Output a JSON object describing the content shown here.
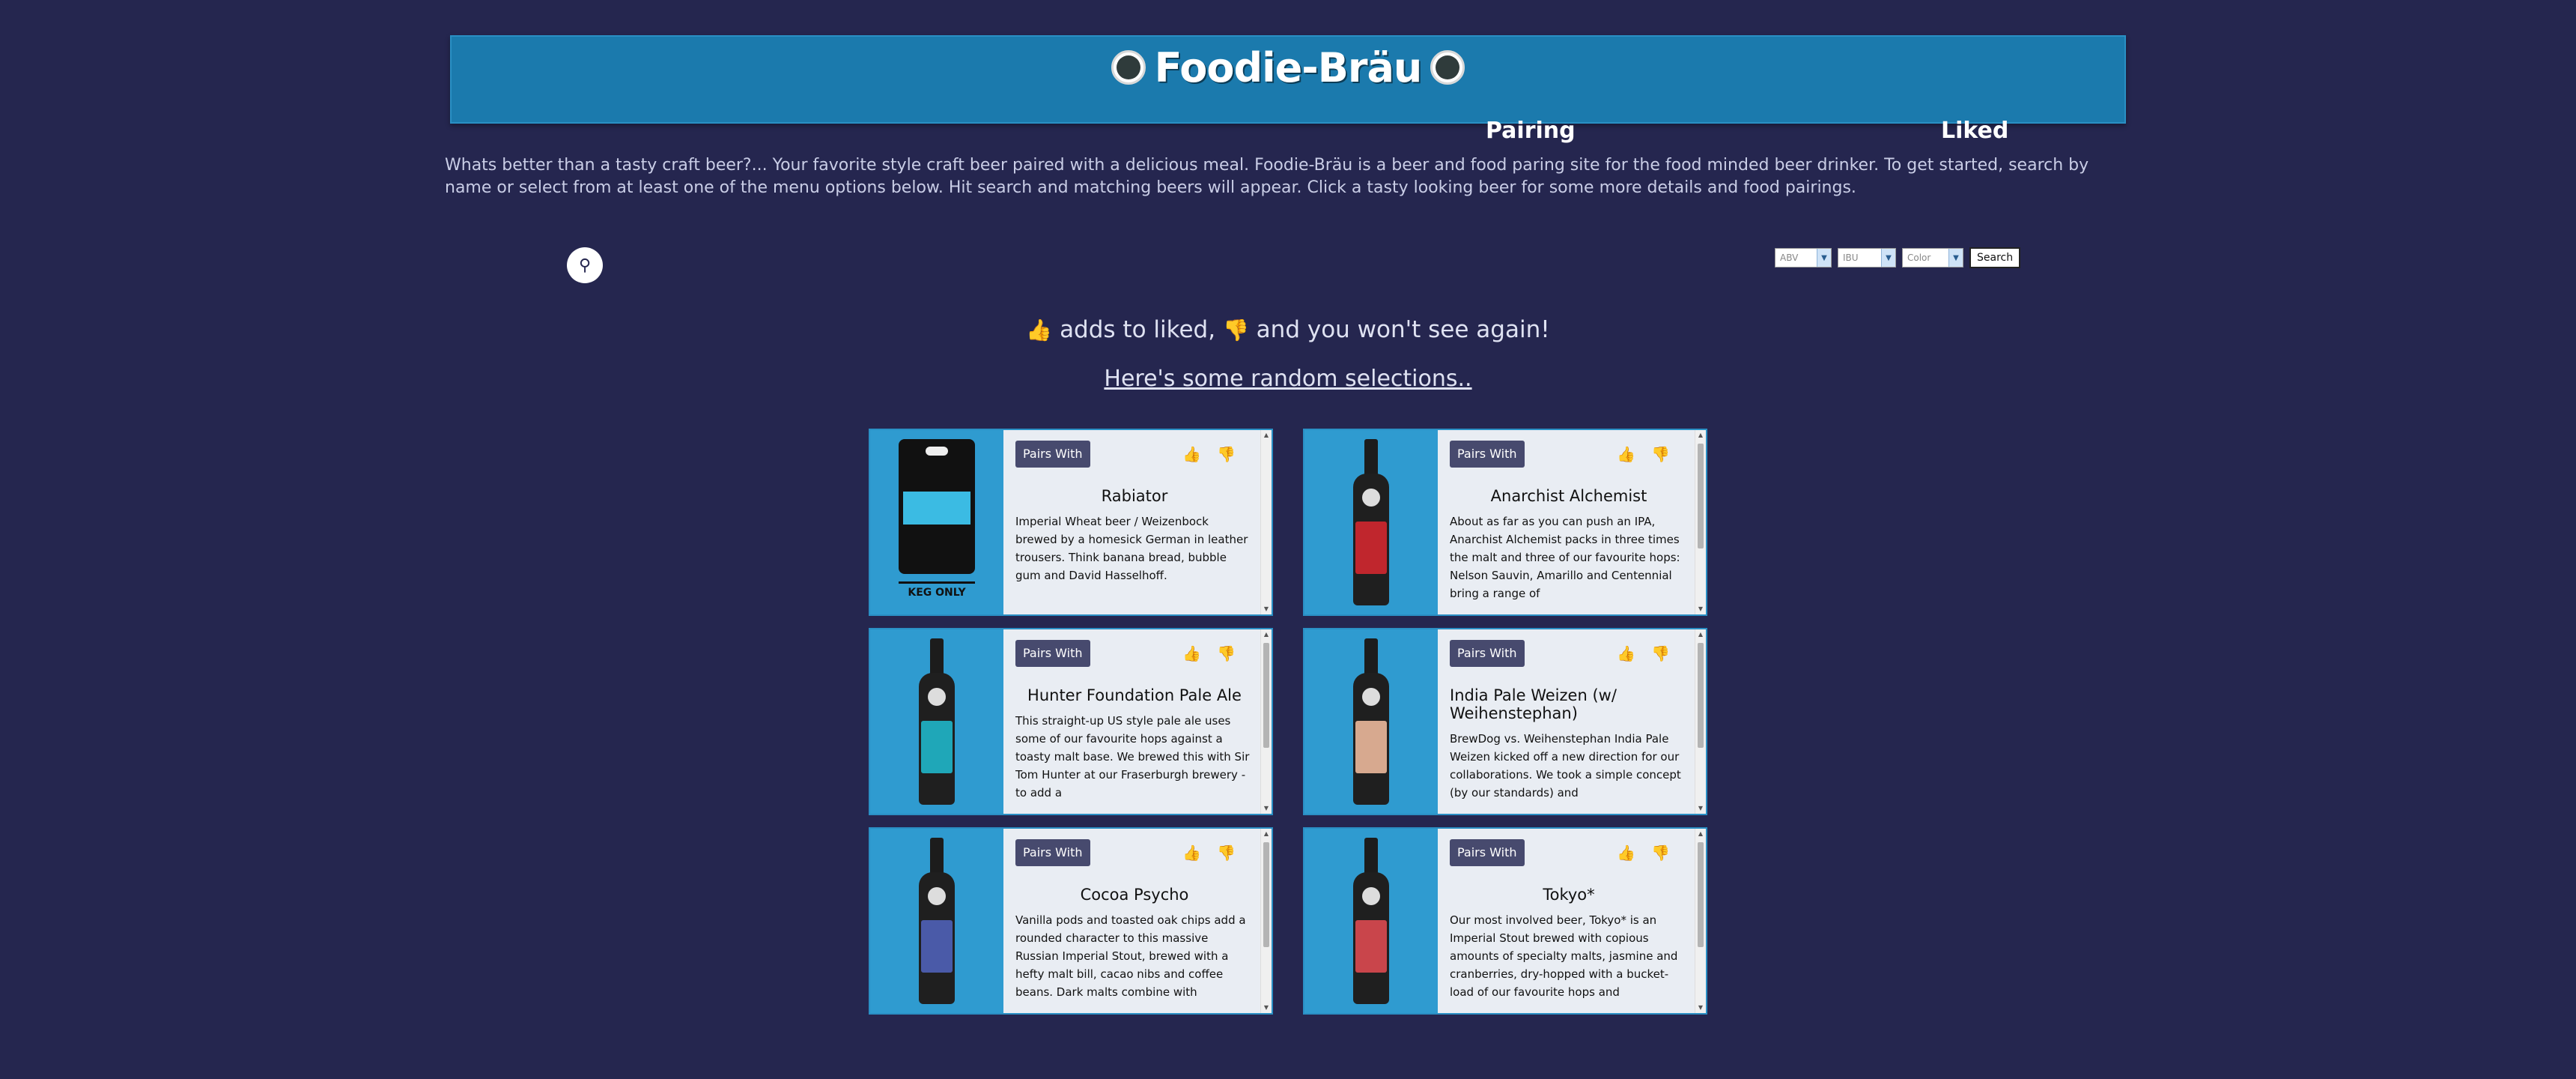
{
  "header": {
    "title": "Foodie-Bräu",
    "nav": {
      "pairing": "Pairing",
      "liked": "Liked"
    }
  },
  "intro": "Whats better than a tasty craft beer?... Your favorite style craft beer paired with a delicious meal. Foodie-Bräu is a beer and food paring site for the food minded beer drinker. To get started, search by name or select from at least one of the menu options below. Hit search and matching beers will appear. Click a tasty looking beer for some more details and food pairings.",
  "filters": {
    "abv": "ABV",
    "ibu": "IBU",
    "color": "Color",
    "search_label": "Search"
  },
  "hint": {
    "text1": "adds to liked,",
    "text2": "and you won't see again!"
  },
  "random_heading": "Here's some random selections..",
  "pairs_label": "Pairs With",
  "keg_only": "KEG ONLY",
  "beers": [
    {
      "name": "Rabiator",
      "description": "Imperial Wheat beer / Weizenbock brewed by a homesick German in leather trousers. Think banana bread, bubble gum and David Hasselhoff.",
      "label_color": "#3bbbe3"
    },
    {
      "name": "Anarchist Alchemist",
      "description": "About as far as you can push an IPA, Anarchist Alchemist packs in three times the malt and three of our favourite hops: Nelson Sauvin, Amarillo and Centennial bring a range of",
      "label_color": "#c0262d"
    },
    {
      "name": "Hunter Foundation Pale Ale",
      "description": "This straight-up US style pale ale uses some of our favourite hops against a toasty malt base. We brewed this with Sir Tom Hunter at our Fraserburgh brewery - to add a",
      "label_color": "#1fa7b8"
    },
    {
      "name": "India Pale Weizen (w/ Weihenstephan)",
      "description": "BrewDog vs. Weihenstephan India Pale Weizen kicked off a new direction for our collaborations. We took a simple concept (by our standards) and",
      "label_color": "#d7a98f"
    },
    {
      "name": "Cocoa Psycho",
      "description": "Vanilla pods and toasted oak chips add a rounded character to this massive Russian Imperial Stout, brewed with a hefty malt bill, cacao nibs and coffee beans. Dark malts combine with",
      "label_color": "#4a5aa8"
    },
    {
      "name": "Tokyo*",
      "description": "Our most involved beer, Tokyo* is an Imperial Stout brewed with copious amounts of specialty malts, jasmine and cranberries, dry-hopped with a bucket-load of our favourite hops and",
      "label_color": "#c9454b"
    }
  ]
}
